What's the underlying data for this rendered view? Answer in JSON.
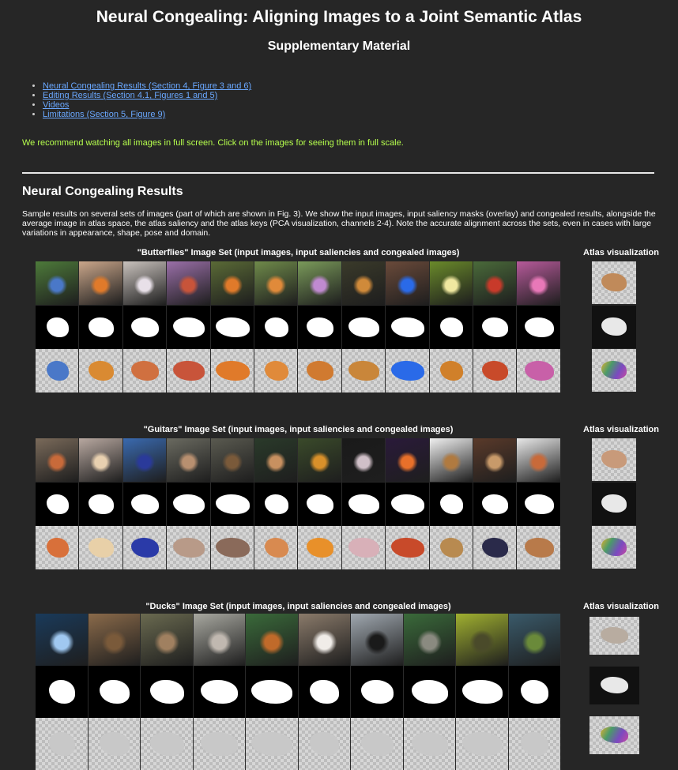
{
  "header": {
    "title": "Neural Congealing: Aligning Images to a Joint Semantic Atlas",
    "subtitle": "Supplementary Material"
  },
  "toc": [
    "Neural Congealing Results (Section 4, Figure 3 and 6)",
    "Editing Results (Section 4.1, Figures 1 and 5)",
    "Videos",
    "Limitations (Section 5, Figure 9)"
  ],
  "note": "We recommend watching all images in full screen. Click on the images for seeing them in full scale.",
  "section": {
    "title": "Neural Congealing Results",
    "description": "Sample results on several sets of images (part of which are shown in Fig. 3). We show the input images, input saliency masks (overlay) and congealed results, alongside the average image in atlas space, the atlas saliency and the atlas keys (PCA visualization, channels 2-4). Note the accurate alignment across the sets, even in cases with large variations in appearance, shape, pose and domain."
  },
  "atlas_label": "Atlas visualization",
  "sets": [
    {
      "title": "\"Butterflies\" Image Set (input images, input saliencies and congealed images)",
      "colors": [
        "#4d7a3a",
        "#caa68a",
        "#c9c2bd",
        "#9a6fa8",
        "#5a6a36",
        "#6f8a4a",
        "#7a9a5a",
        "#3a3a2a",
        "#6a4a3a",
        "#6a8a2a",
        "#4a6a3a",
        "#b65a9a"
      ],
      "accents": [
        "#4a78c8",
        "#e07a2a",
        "#e8e0e8",
        "#c8543a",
        "#e07a2a",
        "#e08a3a",
        "#c08ad0",
        "#d08a3a",
        "#2a6ae8",
        "#f0e8a0",
        "#c83a2a",
        "#e878b8"
      ],
      "congeal": [
        "#4a78c8",
        "#d98a32",
        "#d07040",
        "#c8543a",
        "#e07a2a",
        "#e08a3a",
        "#d07a30",
        "#c9863a",
        "#2a6ae8",
        "#d0802a",
        "#c84a2a",
        "#c860a8"
      ],
      "atlas": [
        "#c08a5a",
        "#1a1a1a",
        "#9a6ab0"
      ]
    },
    {
      "title": "\"Guitars\" Image Set (input images, input saliencies and congealed images)",
      "colors": [
        "#7a6a5a",
        "#b8a8a0",
        "#3a6ab0",
        "#6a6a60",
        "#5a5a50",
        "#2a3a2a",
        "#3a4a2a",
        "#1a1a1a",
        "#2a1a3a",
        "#f0f0f0",
        "#5a3a2a",
        "#e8e8e8"
      ],
      "accents": [
        "#c86a3a",
        "#e8d0b0",
        "#2a3a9a",
        "#b89070",
        "#7a5a3a",
        "#c89060",
        "#d8902a",
        "#d0c0c8",
        "#e8702a",
        "#b07a40",
        "#c89a6a",
        "#c86a3a"
      ],
      "congeal": [
        "#d8703a",
        "#e8d0a8",
        "#2a3aa8",
        "#b89a88",
        "#8a6a5a",
        "#d88a50",
        "#e8902a",
        "#d8b0b8",
        "#c84a2a",
        "#b88a50",
        "#2a2a4a",
        "#b87a4a"
      ],
      "atlas": [
        "#c89a7a",
        "#0a0a0a",
        "#7a5ab0"
      ]
    },
    {
      "title": "\"Ducks\" Image Set (input images, input saliencies and congealed images)",
      "colors": [
        "#1a3a5a",
        "#8a6a4a",
        "#6a6a50",
        "#a8a8a0",
        "#3a6a3a",
        "#8a7a6a",
        "#a0a8b0",
        "#3a6a3a",
        "#a0b030",
        "#3a5a6a"
      ],
      "accents": [
        "#a0c8f0",
        "#7a5a3a",
        "#a08060",
        "#c0b8b0",
        "#c06a2a",
        "#f0ece8",
        "#1a1a1a",
        "#8a8a80",
        "#4a4a2a",
        "#6a8a3a"
      ],
      "congeal": [
        "#c8c8c8",
        "#c8c8c8",
        "#c8c8c8",
        "#c8c8c8",
        "#c8c8c8",
        "#c8c8c8",
        "#c8c8c8",
        "#c8c8c8",
        "#c8c8c8",
        "#c8c8c8"
      ],
      "atlas": [
        "#b8aca0",
        "#0a0a0a",
        "#c8c8c8"
      ]
    }
  ]
}
